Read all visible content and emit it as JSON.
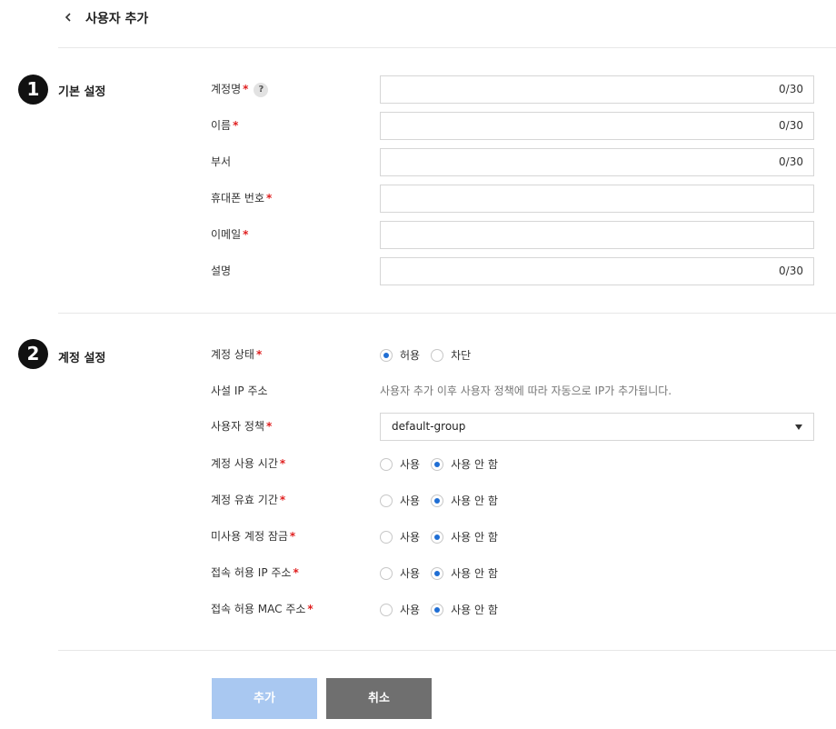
{
  "header": {
    "title": "사용자 추가"
  },
  "basic": {
    "step": "1",
    "title": "기본 설정",
    "fields": [
      {
        "label": "계정명",
        "counter": "0/30"
      },
      {
        "label": "이름",
        "counter": "0/30"
      },
      {
        "label": "부서",
        "counter": "0/30"
      },
      {
        "label": "휴대폰 번호",
        "counter": ""
      },
      {
        "label": "이메일",
        "counter": ""
      },
      {
        "label": "설명",
        "counter": "0/30"
      }
    ]
  },
  "account": {
    "step": "2",
    "title": "계정 설정",
    "status": {
      "label": "계정 상태",
      "options": [
        "허용",
        "차단"
      ],
      "selected": "허용"
    },
    "private_ip": {
      "label": "사설 IP 주소",
      "info": "사용자 추가 이후 사용자 정책에 따라 자동으로 IP가 추가됩니다."
    },
    "policy": {
      "label": "사용자 정책",
      "value": "default-group"
    },
    "toggles": [
      {
        "label": "계정 사용 시간",
        "options": [
          "사용",
          "사용 안 함"
        ],
        "selected": "사용 안 함"
      },
      {
        "label": "계정 유효 기간",
        "options": [
          "사용",
          "사용 안 함"
        ],
        "selected": "사용 안 함"
      },
      {
        "label": "미사용 계정 잠금",
        "options": [
          "사용",
          "사용 안 함"
        ],
        "selected": "사용 안 함"
      },
      {
        "label": "접속 허용 IP 주소",
        "options": [
          "사용",
          "사용 안 함"
        ],
        "selected": "사용 안 함"
      },
      {
        "label": "접속 허용 MAC 주소",
        "options": [
          "사용",
          "사용 안 함"
        ],
        "selected": "사용 안 함"
      }
    ]
  },
  "required_mark": "*",
  "help_mark": "?",
  "buttons": {
    "add": "추가",
    "cancel": "취소"
  },
  "colors": {
    "accent": "#1f6ed4",
    "add_button": "#a9c8f1",
    "cancel_button": "#6f6f6f",
    "required": "#e02020"
  }
}
